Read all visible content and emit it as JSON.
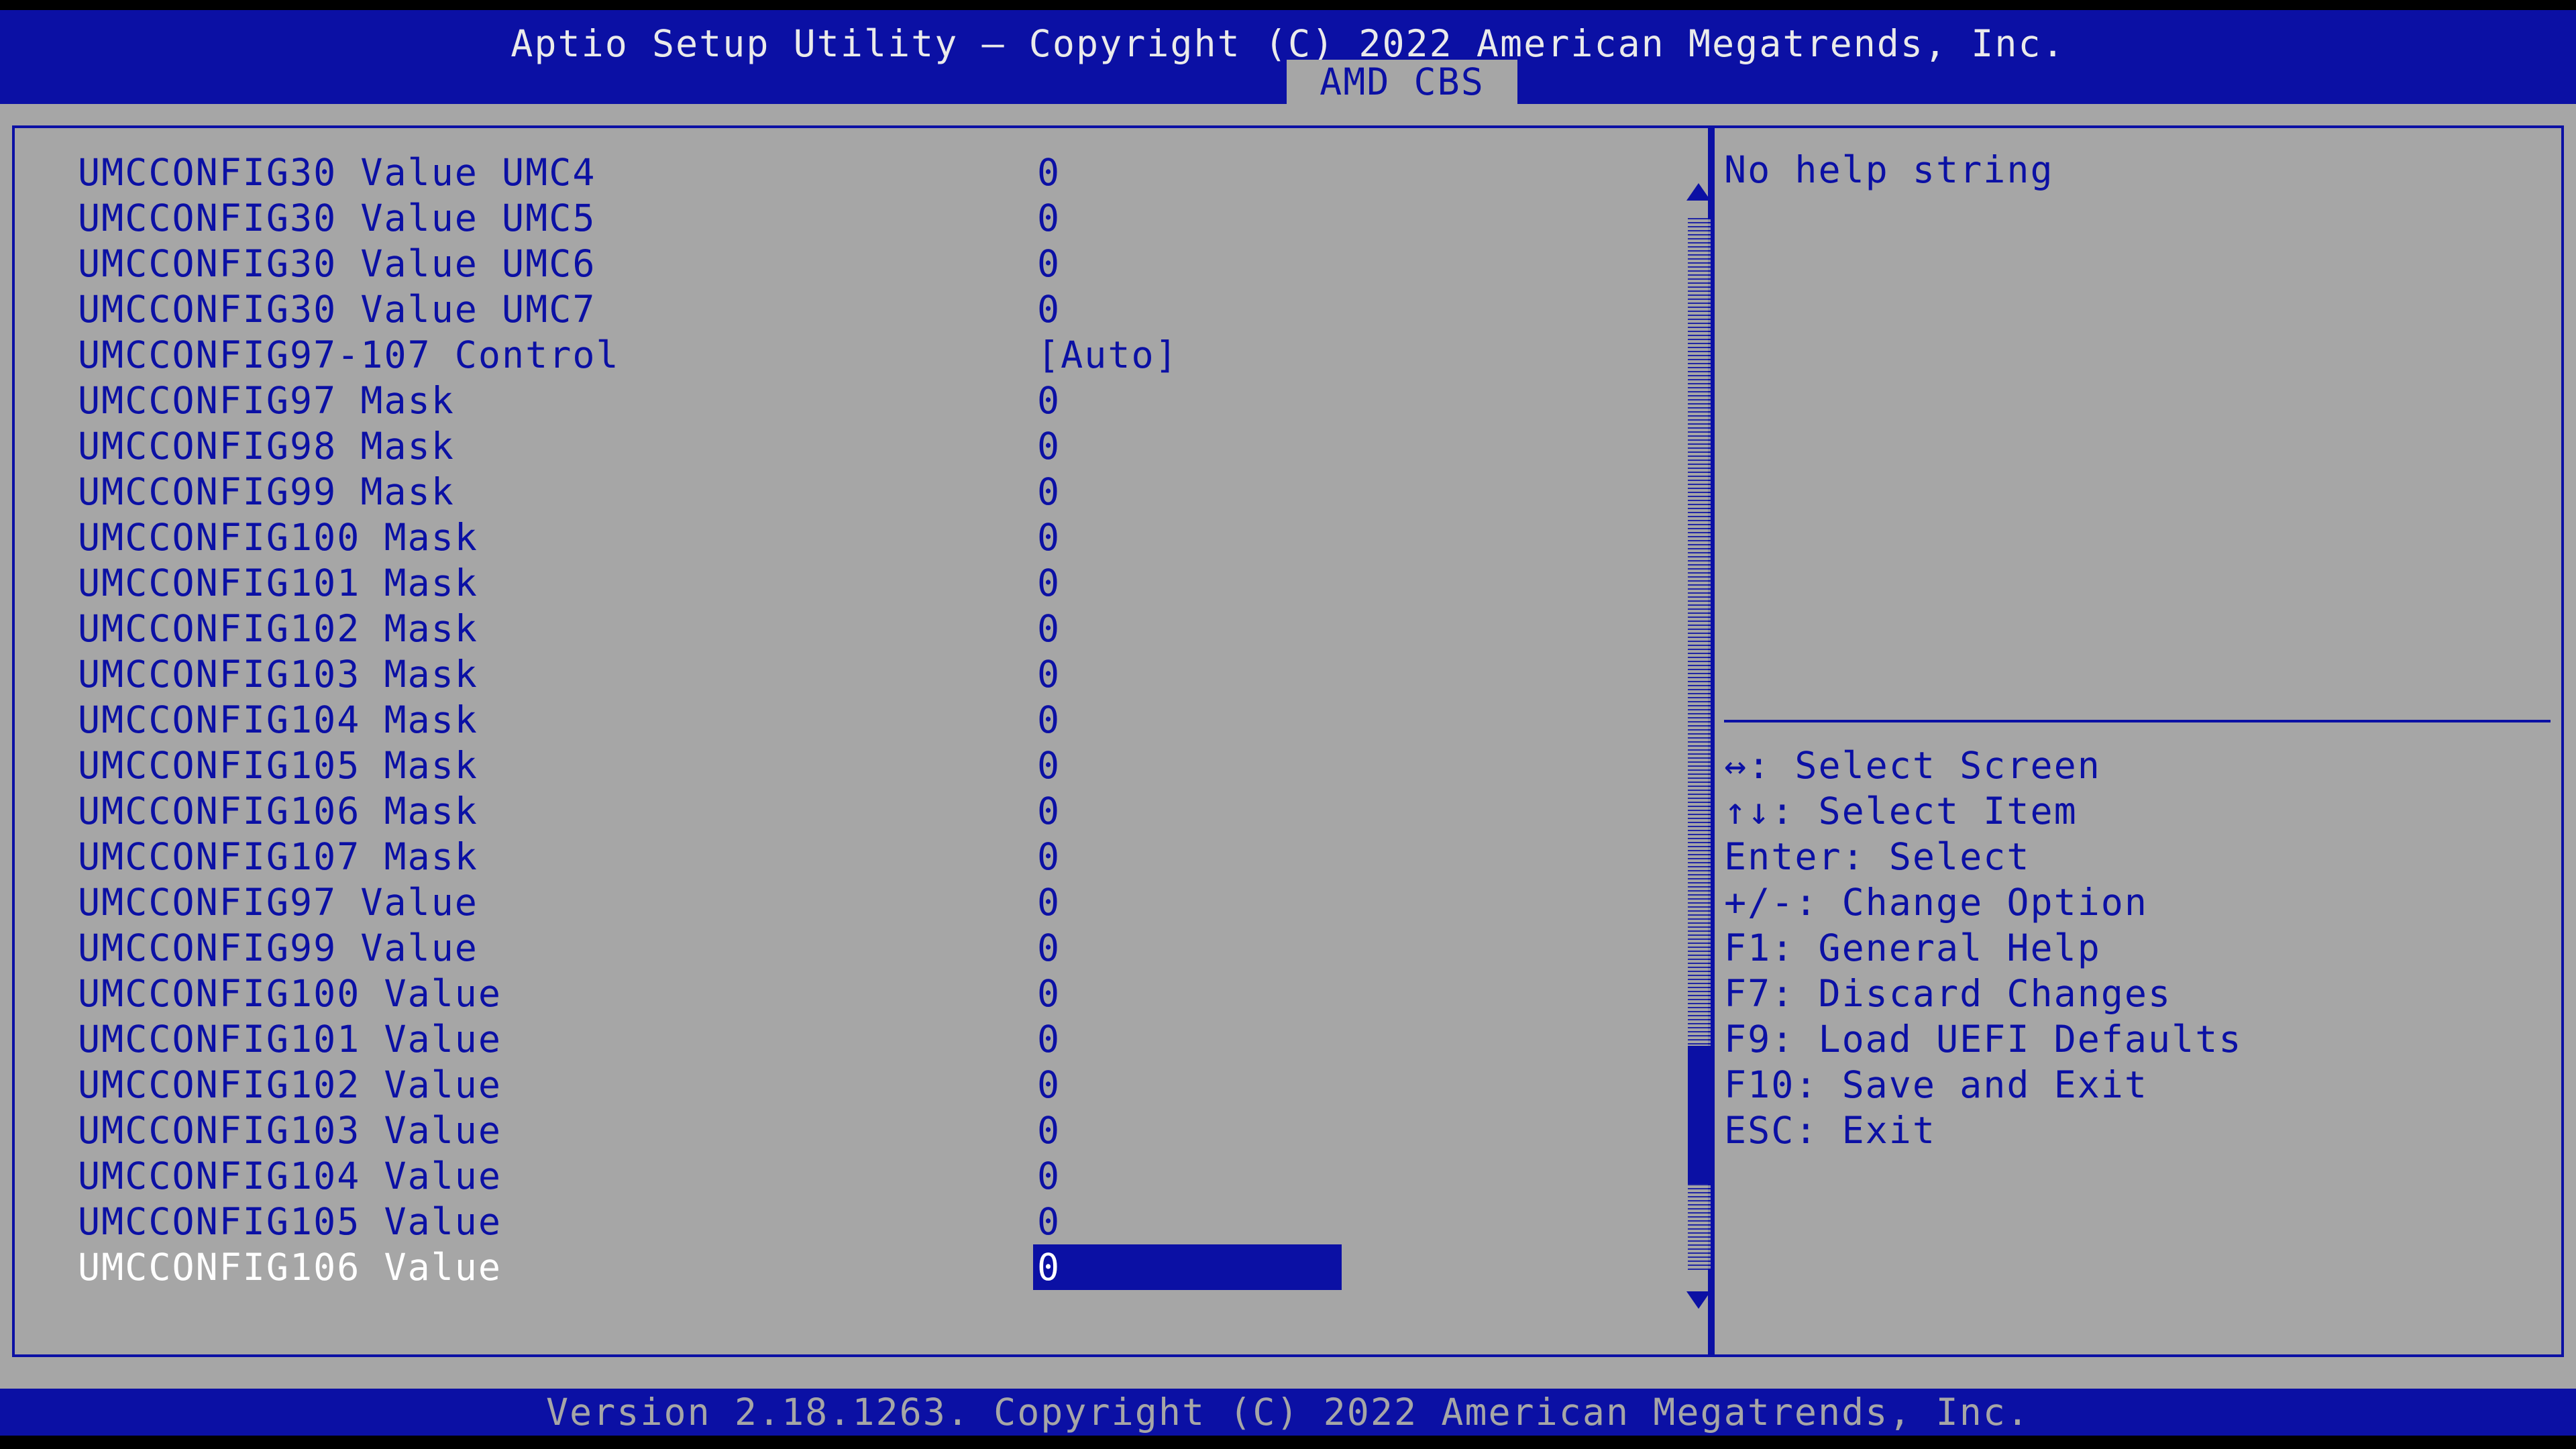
{
  "header": {
    "title": "Aptio Setup Utility – Copyright (C) 2022 American Megatrends, Inc.",
    "tab": "AMD CBS"
  },
  "settings": [
    {
      "label": "UMCCONFIG30 Value UMC4",
      "value": "0"
    },
    {
      "label": "UMCCONFIG30 Value UMC5",
      "value": "0"
    },
    {
      "label": "UMCCONFIG30 Value UMC6",
      "value": "0"
    },
    {
      "label": "UMCCONFIG30 Value UMC7",
      "value": "0"
    },
    {
      "label": "UMCCONFIG97-107 Control",
      "value": "[Auto]"
    },
    {
      "label": "UMCCONFIG97 Mask",
      "value": "0"
    },
    {
      "label": "UMCCONFIG98 Mask",
      "value": "0"
    },
    {
      "label": "UMCCONFIG99 Mask",
      "value": "0"
    },
    {
      "label": "UMCCONFIG100 Mask",
      "value": "0"
    },
    {
      "label": "UMCCONFIG101 Mask",
      "value": "0"
    },
    {
      "label": "UMCCONFIG102 Mask",
      "value": "0"
    },
    {
      "label": "UMCCONFIG103 Mask",
      "value": "0"
    },
    {
      "label": "UMCCONFIG104 Mask",
      "value": "0"
    },
    {
      "label": "UMCCONFIG105 Mask",
      "value": "0"
    },
    {
      "label": "UMCCONFIG106 Mask",
      "value": "0"
    },
    {
      "label": "UMCCONFIG107 Mask",
      "value": "0"
    },
    {
      "label": "UMCCONFIG97 Value",
      "value": "0"
    },
    {
      "label": "UMCCONFIG99 Value",
      "value": "0"
    },
    {
      "label": "UMCCONFIG100 Value",
      "value": "0"
    },
    {
      "label": "UMCCONFIG101 Value",
      "value": "0"
    },
    {
      "label": "UMCCONFIG102 Value",
      "value": "0"
    },
    {
      "label": "UMCCONFIG103 Value",
      "value": "0"
    },
    {
      "label": "UMCCONFIG104 Value",
      "value": "0"
    },
    {
      "label": "UMCCONFIG105 Value",
      "value": "0"
    },
    {
      "label": "UMCCONFIG106 Value",
      "value": "0"
    }
  ],
  "selected_index": 24,
  "help": {
    "text": "No help string",
    "keys": [
      "↔: Select Screen",
      "↑↓: Select Item",
      "Enter: Select",
      "+/-: Change Option",
      "F1: General Help",
      "F7: Discard Changes",
      "F9: Load UEFI Defaults",
      "F10: Save and Exit",
      "ESC: Exit"
    ]
  },
  "footer": {
    "text": "Version 2.18.1263. Copyright (C) 2022 American Megatrends, Inc."
  },
  "colors": {
    "bios_blue": "#0b10a4",
    "panel_gray": "#a6a6a6",
    "highlight_text": "#ffffff"
  },
  "icons": {
    "scroll_up": "triangle-up-icon",
    "scroll_down": "triangle-down-icon"
  }
}
